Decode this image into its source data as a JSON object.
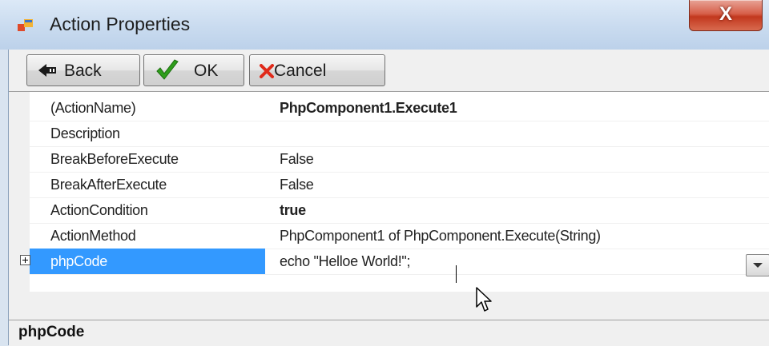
{
  "window": {
    "title": "Action Properties",
    "close_label": "X"
  },
  "toolbar": {
    "back_label": "Back",
    "ok_label": "OK",
    "cancel_label": "Cancel"
  },
  "properties": [
    {
      "name": "(ActionName)",
      "value": "PhpComponent1.Execute1",
      "value_bold": true
    },
    {
      "name": "Description",
      "value": ""
    },
    {
      "name": "BreakBeforeExecute",
      "value": "False"
    },
    {
      "name": "BreakAfterExecute",
      "value": "False"
    },
    {
      "name": "ActionCondition",
      "value": "true",
      "value_bold": true
    },
    {
      "name": "ActionMethod",
      "value": "PhpComponent1 of PhpComponent.Execute(String)"
    },
    {
      "name": "phpCode",
      "value": "echo \"Helloe World!\";",
      "selected": true,
      "expandable": true
    }
  ],
  "help": {
    "title": "phpCode"
  },
  "colors": {
    "selection": "#3399ff",
    "close_button": "#c2381e",
    "ok_check": "#2f9e1c",
    "cancel_x": "#e02a1a"
  },
  "icons": [
    "app-icon",
    "back-arrow-icon",
    "check-icon",
    "cancel-x-icon",
    "expand-plus-icon",
    "dropdown-arrow-icon",
    "mouse-pointer-icon"
  ]
}
